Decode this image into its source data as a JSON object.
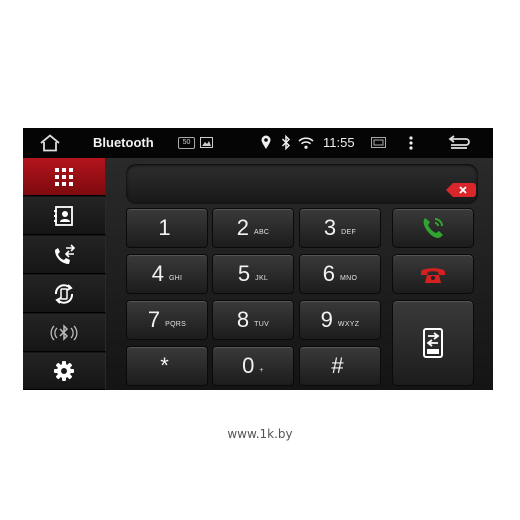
{
  "statusbar": {
    "title": "Bluetooth",
    "time": "11:55",
    "badge": "50"
  },
  "sidebar": {
    "items": [
      {
        "icon": "dialpad-icon",
        "active": true
      },
      {
        "icon": "contacts-icon",
        "active": false
      },
      {
        "icon": "call-log-icon",
        "active": false
      },
      {
        "icon": "phone-sync-icon",
        "active": false
      },
      {
        "icon": "bluetooth-audio-icon",
        "active": false
      },
      {
        "icon": "settings-icon",
        "active": false
      }
    ]
  },
  "keypad": {
    "keys": [
      {
        "digit": "1",
        "letters": ""
      },
      {
        "digit": "2",
        "letters": "ABC"
      },
      {
        "digit": "3",
        "letters": "DEF"
      },
      {
        "digit": "4",
        "letters": "GHI"
      },
      {
        "digit": "5",
        "letters": "JKL"
      },
      {
        "digit": "6",
        "letters": "MNO"
      },
      {
        "digit": "7",
        "letters": "PQRS"
      },
      {
        "digit": "8",
        "letters": "TUV"
      },
      {
        "digit": "9",
        "letters": "WXYZ"
      },
      {
        "digit": "*",
        "letters": ""
      },
      {
        "digit": "0",
        "letters": "+"
      },
      {
        "digit": "#",
        "letters": ""
      }
    ]
  },
  "colors": {
    "accent": "#b3141b",
    "call_green": "#2fa52f",
    "hangup_red": "#d42020"
  },
  "footer": {
    "watermark": "www.1k.by"
  }
}
